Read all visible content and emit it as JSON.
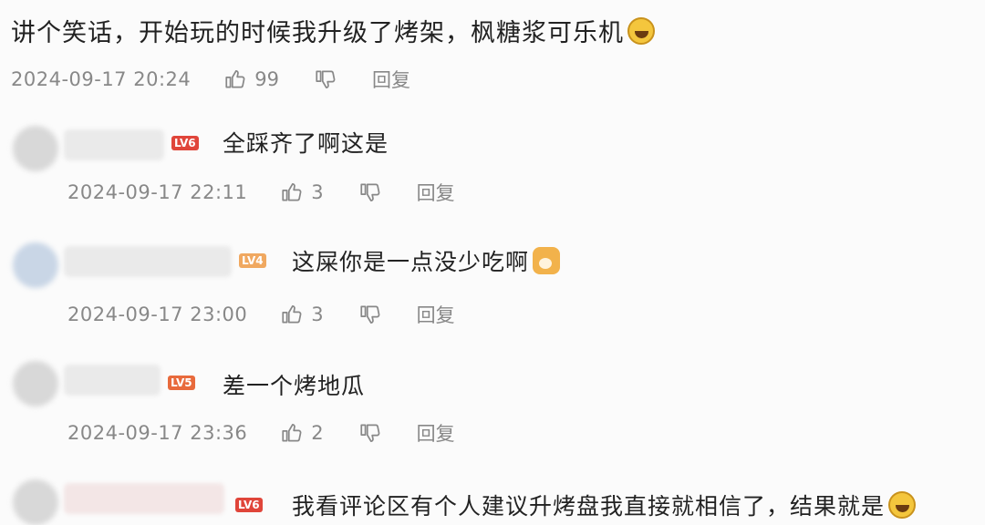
{
  "main_comment": {
    "text": "讲个笑话，开始玩的时候我升级了烤架，枫糖浆可乐机",
    "emoji": "laugh-cry-emoji",
    "time": "2024-09-17 20:24",
    "likes": "99",
    "reply_label": "回复"
  },
  "replies": [
    {
      "level": "LV6",
      "level_color": "#e0453a",
      "text": "全踩齐了啊这是",
      "emoji": "",
      "time": "2024-09-17 22:11",
      "likes": "3",
      "reply_label": "回复"
    },
    {
      "level": "LV4",
      "level_color": "#f0a860",
      "text": "这屎你是一点没少吃啊",
      "emoji": "dog-emoji",
      "time": "2024-09-17 23:00",
      "likes": "3",
      "reply_label": "回复"
    },
    {
      "level": "LV5",
      "level_color": "#e86a3c",
      "text": "差一个烤地瓜",
      "emoji": "",
      "time": "2024-09-17 23:36",
      "likes": "2",
      "reply_label": "回复"
    },
    {
      "level": "LV6",
      "level_color": "#e0453a",
      "text": "我看评论区有个人建议升烤盘我直接就相信了，结果就是",
      "emoji": "laugh-cry-emoji",
      "time": "",
      "likes": "",
      "reply_label": ""
    }
  ]
}
